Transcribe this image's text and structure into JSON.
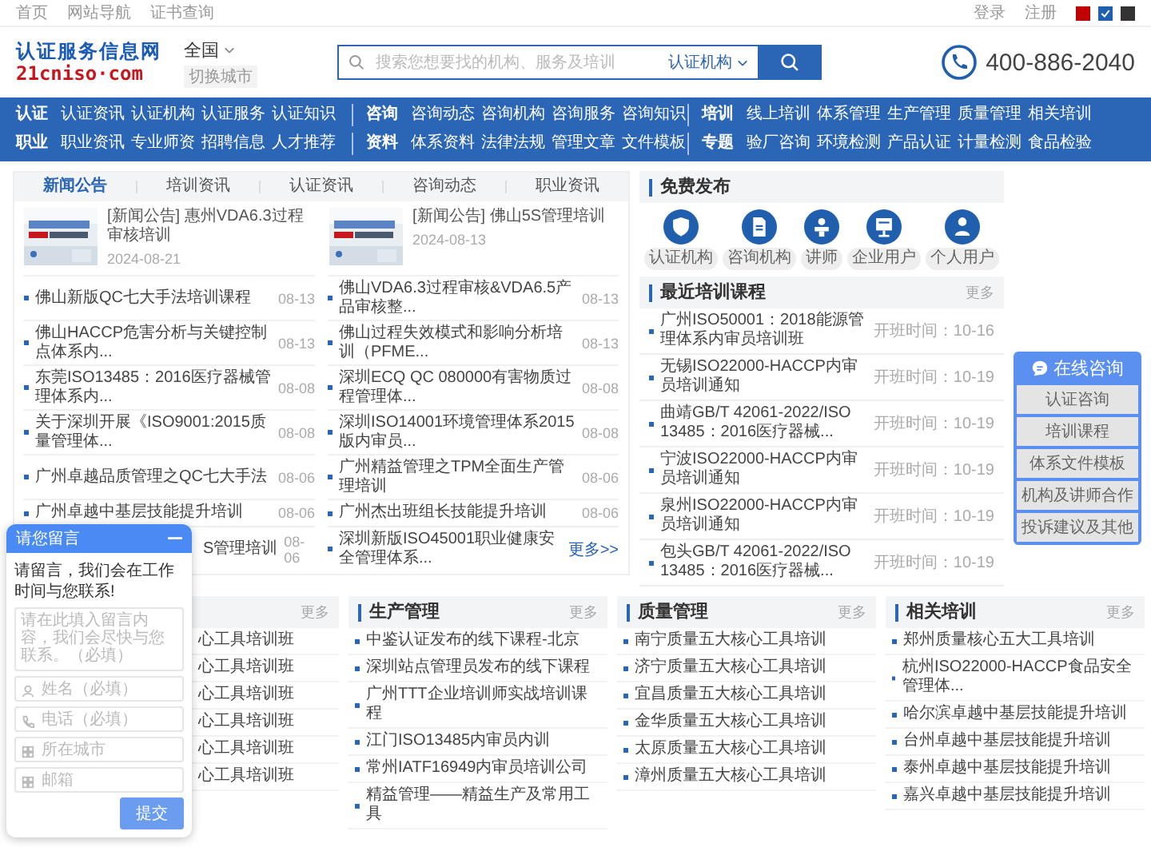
{
  "top_bar": {
    "left_links": [
      "首页",
      "网站导航",
      "证书查询"
    ],
    "right_links": [
      "登录",
      "注册"
    ],
    "theme_swatches": [
      {
        "color": "#c00000",
        "selected": false
      },
      {
        "color": "#1e5fb0",
        "selected": true
      },
      {
        "color": "#333333",
        "selected": false
      }
    ]
  },
  "header": {
    "logo": {
      "title": "认证服务信息网",
      "domain": "21cniso·com"
    },
    "city": "全国",
    "city_switch": "切换城市",
    "search": {
      "placeholder": "搜索您想要找的机构、服务及培训",
      "scope": "认证机构"
    },
    "phone": "400-886-2040"
  },
  "nav": {
    "rows": [
      [
        {
          "title": "认证",
          "links": [
            "认证资讯",
            "认证机构",
            "认证服务",
            "认证知识"
          ]
        },
        {
          "title": "咨询",
          "links": [
            "咨询动态",
            "咨询机构",
            "咨询服务",
            "咨询知识"
          ]
        },
        {
          "title": "培训",
          "links": [
            "线上培训",
            "体系管理",
            "生产管理",
            "质量管理",
            "相关培训"
          ]
        }
      ],
      [
        {
          "title": "职业",
          "links": [
            "职业资讯",
            "专业师资",
            "招聘信息",
            "人才推荐"
          ]
        },
        {
          "title": "资料",
          "links": [
            "体系资料",
            "法律法规",
            "管理文章",
            "文件模板"
          ]
        },
        {
          "title": "专题",
          "links": [
            "验厂咨询",
            "环境检测",
            "产品认证",
            "计量检测",
            "食品检验"
          ]
        }
      ]
    ]
  },
  "news": {
    "tabs": [
      {
        "label": "新闻公告",
        "selected": true
      },
      {
        "label": "培训资讯",
        "selected": false
      },
      {
        "label": "认证资讯",
        "selected": false
      },
      {
        "label": "咨询动态",
        "selected": false
      },
      {
        "label": "职业资讯",
        "selected": false
      }
    ],
    "featured": [
      {
        "title": "[新闻公告] 惠州VDA6.3过程审核培训",
        "date": "2024-08-21"
      },
      {
        "title": "[新闻公告] 佛山5S管理培训",
        "date": "2024-08-13"
      }
    ],
    "columns": [
      [
        {
          "title": "佛山新版QC七大手法培训课程",
          "date": "08-13"
        },
        {
          "title": "佛山HACCP危害分析与关键控制点体系内...",
          "date": "08-13"
        },
        {
          "title": "东莞ISO13485：2016医疗器械管理体系内...",
          "date": "08-08"
        },
        {
          "title": "关于深圳开展《ISO9001:2015质量管理体...",
          "date": "08-08"
        },
        {
          "title": "广州卓越品质管理之QC七大手法",
          "date": "08-06"
        },
        {
          "title": "广州卓越中基层技能提升培训",
          "date": "08-06"
        },
        {
          "title": "S管理培训",
          "date": "08-06",
          "covered": true
        }
      ],
      [
        {
          "title": "佛山VDA6.3过程审核&VDA6.5产品审核整...",
          "date": "08-13"
        },
        {
          "title": "佛山过程失效模式和影响分析培训（PFME...",
          "date": "08-13"
        },
        {
          "title": "深圳ECQ QC 080000有害物质过程管理体...",
          "date": "08-08"
        },
        {
          "title": "深圳ISO14001环境管理体系2015版内审员...",
          "date": "08-08"
        },
        {
          "title": "广州精益管理之TPM全面生产管理培训",
          "date": "08-06"
        },
        {
          "title": "广州杰出班组长技能提升培训",
          "date": "08-06"
        },
        {
          "title": "深圳新版ISO45001职业健康安全管理体系...",
          "more": "更多>>"
        }
      ]
    ]
  },
  "free_publish": {
    "title": "免费发布",
    "items": [
      {
        "label": "认证机构",
        "kind": "certification"
      },
      {
        "label": "咨询机构",
        "kind": "consulting"
      },
      {
        "label": "讲师",
        "kind": "lecturer"
      },
      {
        "label": "企业用户",
        "kind": "enterprise"
      },
      {
        "label": "个人用户",
        "kind": "personal"
      }
    ]
  },
  "recent_courses": {
    "title": "最近培训课程",
    "more": "更多",
    "items": [
      {
        "title": "广州ISO50001：2018能源管理体系内审员培训班",
        "time": "开班时间：10-16"
      },
      {
        "title": "无锡ISO22000-HACCP内审员培训通知",
        "time": "开班时间：10-19"
      },
      {
        "title": "曲靖GB/T 42061-2022/ISO 13485：2016医疗器械...",
        "time": "开班时间：10-19"
      },
      {
        "title": "宁波ISO22000-HACCP内审员培训通知",
        "time": "开班时间：10-19"
      },
      {
        "title": "泉州ISO22000-HACCP内审员培训通知",
        "time": "开班时间：10-19"
      },
      {
        "title": "包头GB/T 42061-2022/ISO 13485：2016医疗器械...",
        "time": "开班时间：10-19"
      }
    ]
  },
  "categories": [
    {
      "more": "更多",
      "covered": true,
      "items": [
        "心工具培训班",
        "心工具培训班",
        "心工具培训班",
        "心工具培训班",
        "心工具培训班",
        "心工具培训班"
      ]
    },
    {
      "title": "生产管理",
      "more": "更多",
      "covered": false,
      "items": [
        "中鉴认证发布的线下课程-北京",
        "深圳站点管理员发布的线下课程",
        "广州TTT企业培训师实战培训课程",
        "江门ISO13485内审员内训",
        "常州IATF16949内审员培训公司",
        "精益管理——精益生产及常用工具"
      ]
    },
    {
      "title": "质量管理",
      "more": "更多",
      "covered": false,
      "items": [
        "南宁质量五大核心工具培训",
        "济宁质量五大核心工具培训",
        "宜昌质量五大核心工具培训",
        "金华质量五大核心工具培训",
        "太原质量五大核心工具培训",
        "漳州质量五大核心工具培训"
      ]
    },
    {
      "title": "相关培训",
      "more": "更多",
      "covered": false,
      "items": [
        "郑州质量核心五大工具培训",
        "杭州ISO22000-HACCP食品安全管理体...",
        "哈尔滨卓越中基层技能提升培训",
        "台州卓越中基层技能提升培训",
        "泰州卓越中基层技能提升培训",
        "嘉兴卓越中基层技能提升培训"
      ]
    }
  ],
  "online_consult": {
    "title": "在线咨询",
    "items": [
      "认证咨询",
      "培训课程",
      "体系文件模板",
      "机构及讲师合作",
      "投诉建议及其他"
    ]
  },
  "message_widget": {
    "title": "请您留言",
    "intro": "请留言，我们会在工作时间与您联系!",
    "textarea_placeholder": "请在此填入留言内容，我们会尽快与您联系。（必填）",
    "fields": [
      {
        "placeholder": "姓名（必填）",
        "kind": "name"
      },
      {
        "placeholder": "电话（必填）",
        "kind": "phone"
      },
      {
        "placeholder": "所在城市",
        "kind": "city"
      },
      {
        "placeholder": "邮箱",
        "kind": "email"
      }
    ],
    "submit": "提交"
  }
}
